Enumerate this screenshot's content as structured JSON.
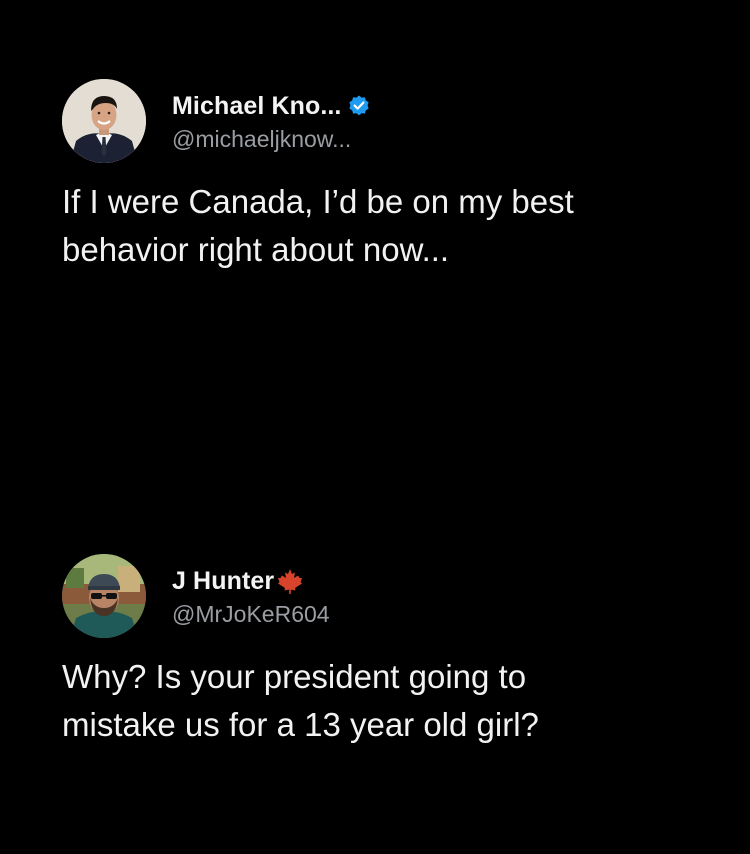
{
  "tweets": [
    {
      "display_name": "Michael Kno...",
      "handle": "@michaeljknow...",
      "badge_icon": "verified-badge-icon",
      "badge_color": "#1d9bf0",
      "text": "If I were Canada, I’d be on my best\nbehavior right about now..."
    },
    {
      "display_name": "J Hunter",
      "handle": "@MrJoKeR604",
      "badge_icon": "maple-leaf-icon",
      "badge_color": "#d8432b",
      "text": "Why? Is your president going to\nmistake us for a 13 year old girl?"
    }
  ],
  "colors": {
    "background": "#000000",
    "text": "#f2f2f2",
    "handle": "#9a9ea3"
  }
}
